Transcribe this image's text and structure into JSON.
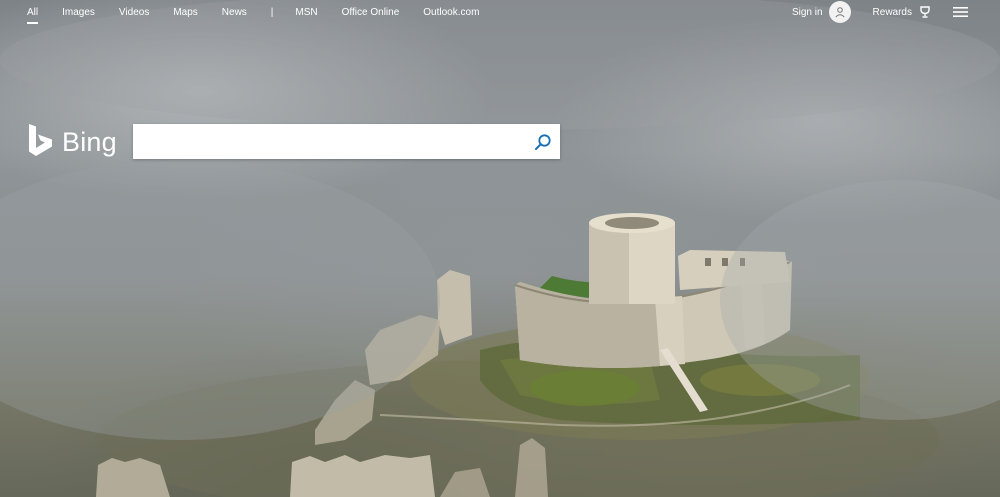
{
  "nav": {
    "links": [
      "All",
      "Images",
      "Videos",
      "Maps",
      "News"
    ],
    "separator": "|",
    "external_links": [
      "MSN",
      "Office Online",
      "Outlook.com"
    ],
    "active": "All"
  },
  "account": {
    "sign_in_label": "Sign in",
    "rewards_label": "Rewards",
    "avatar_icon": "user-icon",
    "rewards_icon": "trophy-icon",
    "menu_icon": "hamburger-menu-icon"
  },
  "brand": {
    "logo_text": "Bing",
    "logo_icon": "bing-b-icon"
  },
  "search": {
    "value": "",
    "placeholder": "",
    "button_icon": "search-icon",
    "accent": "#1a6fb3"
  }
}
